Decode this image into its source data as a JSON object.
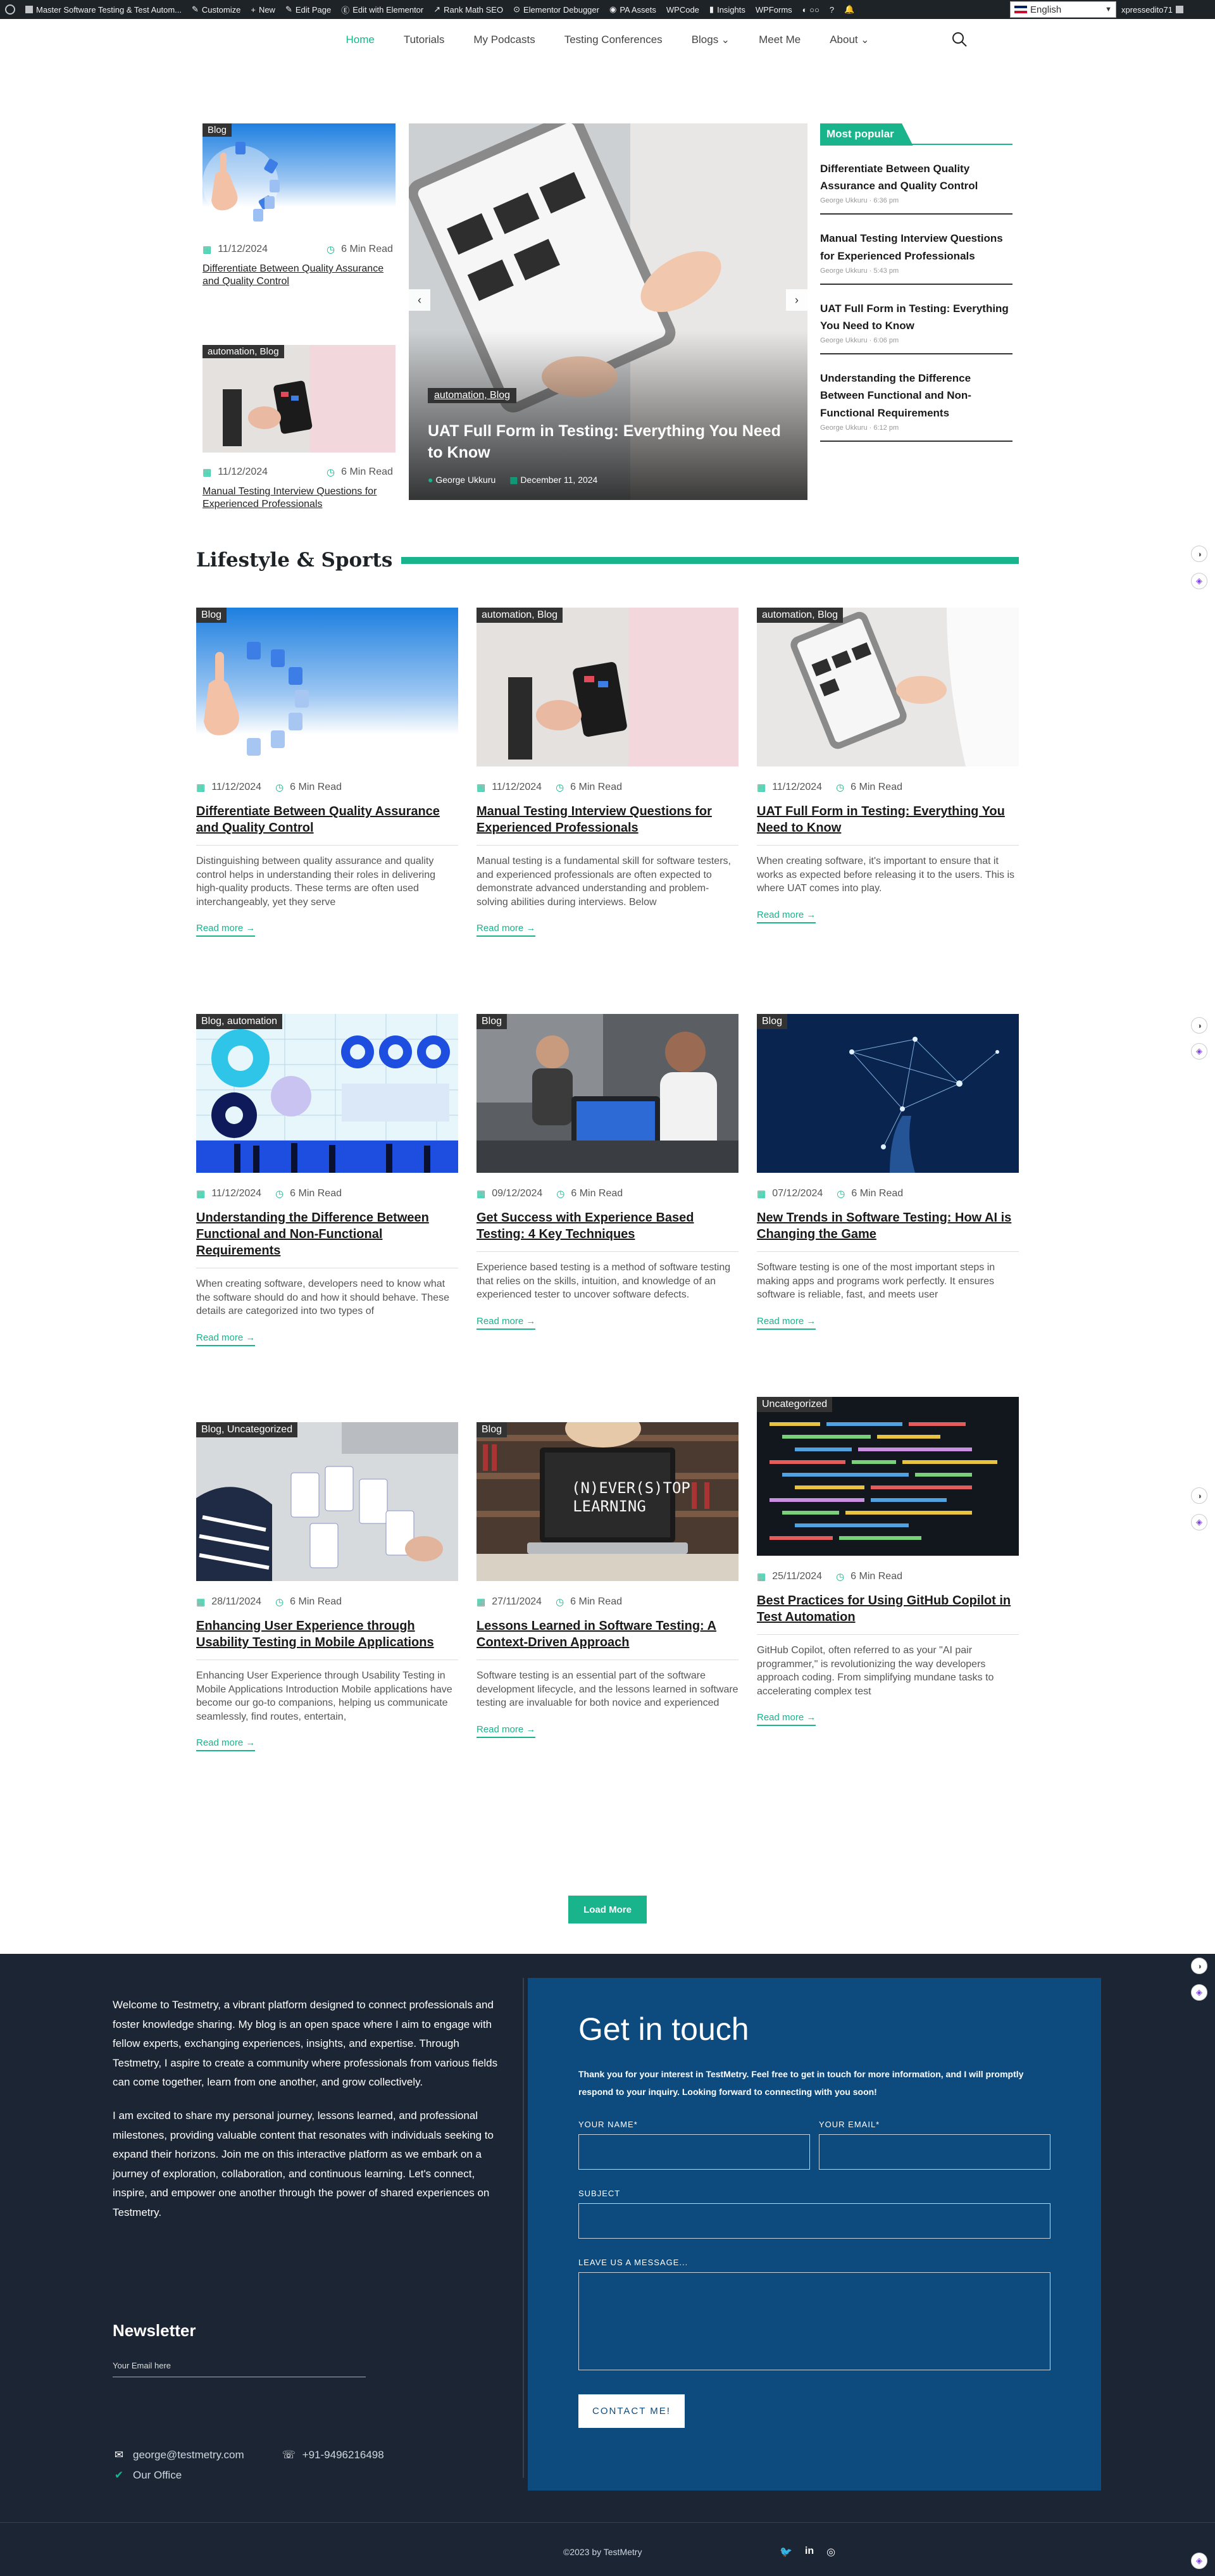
{
  "admin_bar": {
    "site_name": "Master Software Testing & Test Autom...",
    "items": [
      "Customize",
      "New",
      "Edit Page",
      "Edit with Elementor",
      "Rank Math SEO",
      "Elementor Debugger",
      "PA Assets",
      "WPCode",
      "Insights",
      "WPForms"
    ],
    "user": "xpressedito71",
    "language": "English"
  },
  "nav": {
    "items": [
      "Home",
      "Tutorials",
      "My Podcasts",
      "Testing Conferences",
      "Blogs",
      "Meet Me",
      "About"
    ]
  },
  "hero": {
    "left_cards": [
      {
        "badge": "Blog",
        "date": "11/12/2024",
        "read": "6 Min Read",
        "title": "Differentiate Between Quality Assurance and Quality Control"
      },
      {
        "badge": "automation, Blog",
        "date": "11/12/2024",
        "read": "6 Min Read",
        "title": "Manual Testing Interview Questions for Experienced Professionals"
      }
    ],
    "slide": {
      "badge": "automation, Blog",
      "title": "UAT Full Form in Testing: Everything You Need to Know",
      "author": "George Ukkuru",
      "date": "December 11, 2024"
    },
    "popular": {
      "heading": "Most popular",
      "items": [
        {
          "title": "Differentiate Between Quality Assurance and Quality Control",
          "meta": "George Ukkuru · 6:36 pm"
        },
        {
          "title": "Manual Testing Interview Questions for Experienced Professionals",
          "meta": "George Ukkuru · 5:43 pm"
        },
        {
          "title": "UAT Full Form in Testing: Everything You Need to Know",
          "meta": "George Ukkuru · 6:06 pm"
        },
        {
          "title": "Understanding the Difference Between Functional and Non-Functional Requirements",
          "meta": "George Ukkuru · 6:12 pm"
        }
      ]
    }
  },
  "section": {
    "title": "Lifestyle & Sports"
  },
  "posts": [
    {
      "badge": "Blog",
      "date": "11/12/2024",
      "read": "6 Min Read",
      "title": "Differentiate Between Quality Assurance and Quality Control",
      "excerpt": "Distinguishing between quality assurance and quality control helps in understanding their roles in delivering high-quality products. These terms are often used interchangeably, yet they serve",
      "more": "Read more"
    },
    {
      "badge": "automation, Blog",
      "date": "11/12/2024",
      "read": "6 Min Read",
      "title": "Manual Testing Interview Questions for Experienced Professionals",
      "excerpt": "Manual testing is a fundamental skill for software testers, and experienced professionals are often expected to demonstrate advanced understanding and problem-solving abilities during interviews. Below",
      "more": "Read more"
    },
    {
      "badge": "automation, Blog",
      "date": "11/12/2024",
      "read": "6 Min Read",
      "title": "UAT Full Form in Testing: Everything You Need to Know",
      "excerpt": "When creating software, it's important to ensure that it works as expected before releasing it to the users. This is where UAT comes into play.",
      "more": "Read more"
    },
    {
      "badge": "Blog, automation",
      "date": "11/12/2024",
      "read": "6 Min Read",
      "title": "Understanding the Difference Between Functional and Non-Functional Requirements",
      "excerpt": "When creating software, developers need to know what the software should do and how it should behave. These details are categorized into two types of",
      "more": "Read more"
    },
    {
      "badge": "Blog",
      "date": "09/12/2024",
      "read": "6 Min Read",
      "title": "Get Success with Experience Based Testing: 4 Key Techniques",
      "excerpt": "Experience based testing is a method of software testing that relies on the skills, intuition, and knowledge of an experienced tester to uncover software defects.",
      "more": "Read more"
    },
    {
      "badge": "Blog",
      "date": "07/12/2024",
      "read": "6 Min Read",
      "title": "New Trends in Software Testing: How AI is Changing the Game",
      "excerpt": "Software testing is one of the most important steps in making apps and programs work perfectly. It ensures software is reliable, fast, and meets user",
      "more": "Read more"
    },
    {
      "badge": "Blog, Uncategorized",
      "date": "28/11/2024",
      "read": "6 Min Read",
      "title": "Enhancing User Experience through Usability Testing in Mobile Applications",
      "excerpt": "Enhancing User Experience through Usability Testing in Mobile Applications   Introduction Mobile applications have become our go-to companions, helping us communicate seamlessly, find routes, entertain,",
      "more": "Read more"
    },
    {
      "badge": "Blog",
      "date": "27/11/2024",
      "read": "6 Min Read",
      "title": "Lessons Learned in Software Testing: A Context-Driven Approach",
      "excerpt": "Software testing is an essential part of the software development lifecycle, and the lessons learned in software testing are invaluable for both novice and experienced",
      "more": "Read more"
    },
    {
      "badge": "Uncategorized",
      "date": "25/11/2024",
      "read": "6 Min Read",
      "title": "Best Practices for Using GitHub Copilot in Test Automation",
      "excerpt": "GitHub Copilot, often referred to as your \"AI pair programmer,\" is revolutionizing the way developers approach coding. From simplifying mundane tasks to accelerating complex test",
      "more": "Read more"
    }
  ],
  "load_more": "Load More",
  "footer": {
    "about_p1": "Welcome to Testmetry, a vibrant platform designed to connect professionals and foster knowledge sharing. My blog is an open space where I aim to engage with fellow experts, exchanging experiences, insights, and expertise. Through Testmetry, I aspire to create a community where professionals from various fields can come together, learn from one another, and grow collectively.",
    "about_p2": "I am excited to share my personal journey, lessons learned, and professional milestones, providing valuable content that resonates with individuals seeking to expand their horizons. Join me on this interactive platform as we embark on a journey of exploration, collaboration, and continuous learning. Let's connect, inspire, and empower one another through the power of shared experiences on Testmetry.",
    "newsletter_title": "Newsletter",
    "newsletter_placeholder": "Your Email here",
    "email": "george@testmetry.com",
    "phone": "+91-9496216498",
    "office": "Our Office",
    "copyright": "©2023 by TestMetry"
  },
  "contact": {
    "title": "Get in touch",
    "lead": "Thank you for your interest in TestMetry. Feel free to get in touch for more information, and I will promptly respond to your inquiry. Looking forward to connecting with you soon!",
    "name_label": "YOUR NAME*",
    "email_label": "YOUR EMAIL*",
    "subject_label": "SUBJECT",
    "message_label": "LEAVE US A MESSAGE...",
    "button": "CONTACT ME!"
  },
  "colors": {
    "accent": "#19b38c",
    "admin_bar": "#1d2327",
    "footer": "#1c2533",
    "contact_panel": "#0d4a7d"
  }
}
